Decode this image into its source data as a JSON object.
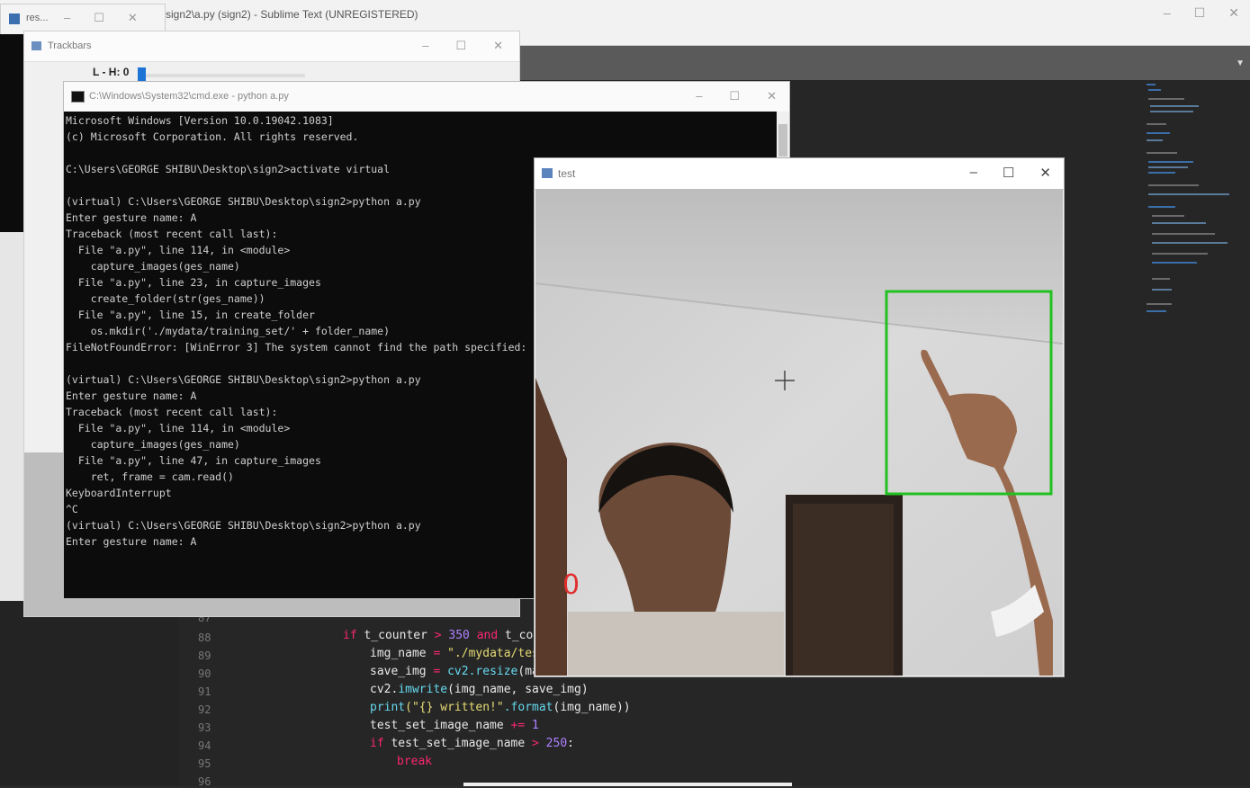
{
  "sublime": {
    "title": "sign2\\a.py (sign2) - Sublime Text (UNREGISTERED)",
    "controls": [
      "–",
      "☐",
      "✕"
    ],
    "tab_dropdown": "▼",
    "line_numbers": [
      "87",
      "88",
      "89",
      "90",
      "91",
      "92",
      "93",
      "94",
      "95",
      "96"
    ],
    "code": {
      "l88_kw": "if",
      "l88_var": " t_counter ",
      "l88_op": ">",
      "l88_num": " 350 ",
      "l88_and": "and",
      "l88_rest": " t_cou",
      "l89_a": "img_name ",
      "l89_op": "=",
      "l89_str": " \"./mydata/tes",
      "l90_a": "save_img ",
      "l90_op": "=",
      "l90_fn": " cv2.resize",
      "l90_b": "(ma",
      "l91_a": "cv2.",
      "l91_fn": "imwrite",
      "l91_b": "(img_name, save_img)",
      "l92_fn": "print",
      "l92_str": "(\"{} written!\"",
      "l92_fn2": ".format",
      "l92_b": "(img_name))",
      "l93_a": "test_set_image_name ",
      "l93_op": "+=",
      "l93_num": " 1",
      "l94_kw": "if",
      "l94_a": " test_set_image_name ",
      "l94_op": ">",
      "l94_num": " 250",
      "l94_b": ":",
      "l95_kw": "break"
    }
  },
  "res_window": {
    "title": "res...",
    "controls": [
      "–",
      "☐",
      "✕"
    ]
  },
  "trackbars_window": {
    "title": "Trackbars",
    "controls": [
      "–",
      "☐",
      "✕"
    ],
    "slider_label": "L - H: 0",
    "slider_value_fraction": 0.0
  },
  "cmd_window": {
    "title": "C:\\Windows\\System32\\cmd.exe - python a.py",
    "controls": [
      "–",
      "☐",
      "✕"
    ],
    "lines": [
      "Microsoft Windows [Version 10.0.19042.1083]",
      "(c) Microsoft Corporation. All rights reserved.",
      "",
      "C:\\Users\\GEORGE SHIBU\\Desktop\\sign2>activate virtual",
      "",
      "(virtual) C:\\Users\\GEORGE SHIBU\\Desktop\\sign2>python a.py",
      "Enter gesture name: A",
      "Traceback (most recent call last):",
      "  File \"a.py\", line 114, in <module>",
      "    capture_images(ges_name)",
      "  File \"a.py\", line 23, in capture_images",
      "    create_folder(str(ges_name))",
      "  File \"a.py\", line 15, in create_folder",
      "    os.mkdir('./mydata/training_set/' + folder_name)",
      "FileNotFoundError: [WinError 3] The system cannot find the path specified: './m",
      "",
      "(virtual) C:\\Users\\GEORGE SHIBU\\Desktop\\sign2>python a.py",
      "Enter gesture name: A",
      "Traceback (most recent call last):",
      "  File \"a.py\", line 114, in <module>",
      "    capture_images(ges_name)",
      "  File \"a.py\", line 47, in capture_images",
      "    ret, frame = cam.read()",
      "KeyboardInterrupt",
      "^C",
      "(virtual) C:\\Users\\GEORGE SHIBU\\Desktop\\sign2>python a.py",
      "Enter gesture name: A"
    ]
  },
  "test_window": {
    "title": "test",
    "controls": [
      "–",
      "☐",
      "✕"
    ],
    "overlay_digit": "0",
    "roi_color": "#22c020",
    "digit_color": "#e03030"
  }
}
